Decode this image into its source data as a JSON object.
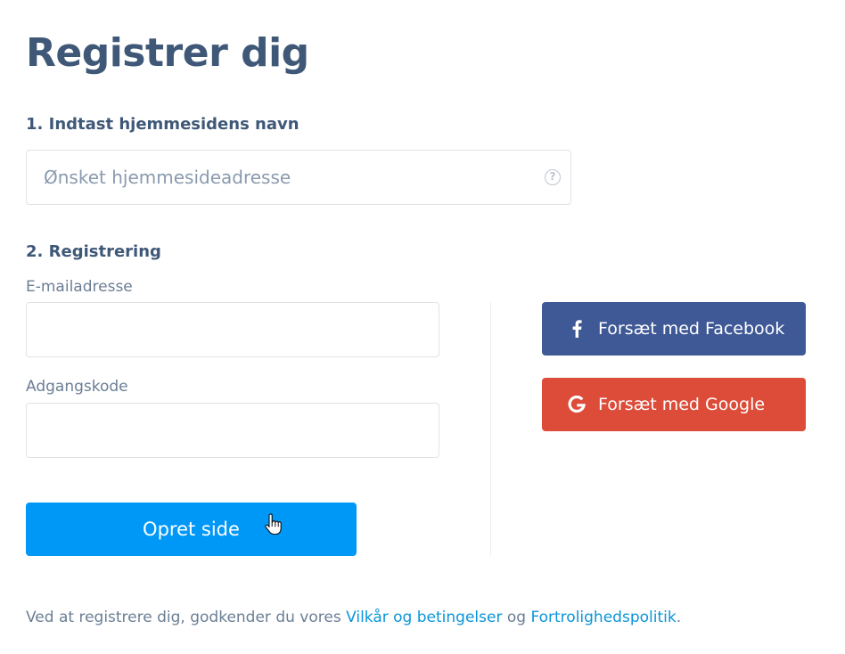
{
  "page": {
    "title": "Registrer dig"
  },
  "step1": {
    "label": "1. Indtast hjemmesidens navn",
    "site_input": {
      "value": "",
      "placeholder": "Ønsket hjemmesideadresse",
      "help_icon": "question-circle-icon",
      "help_glyph": "?"
    }
  },
  "step2": {
    "label": "2. Registrering",
    "email": {
      "label": "E-mailadresse",
      "value": "",
      "placeholder": ""
    },
    "password": {
      "label": "Adgangskode",
      "value": "",
      "placeholder": ""
    },
    "submit_label": "Opret side"
  },
  "social": {
    "facebook": {
      "label": "Forsæt med Facebook",
      "icon": "facebook-icon",
      "color": "#3f5896"
    },
    "google": {
      "label": "Forsæt med Google",
      "icon": "google-icon",
      "color": "#dd4b39"
    }
  },
  "terms": {
    "prefix": "Ved at registrere dig, godkender du vores ",
    "terms_link": "Vilkår og betingelser",
    "middle": " og ",
    "privacy_link": "Fortrolighedspolitik",
    "suffix": "."
  },
  "colors": {
    "heading": "#3f5878",
    "primary": "#0098f7",
    "link": "#0a95d9"
  }
}
